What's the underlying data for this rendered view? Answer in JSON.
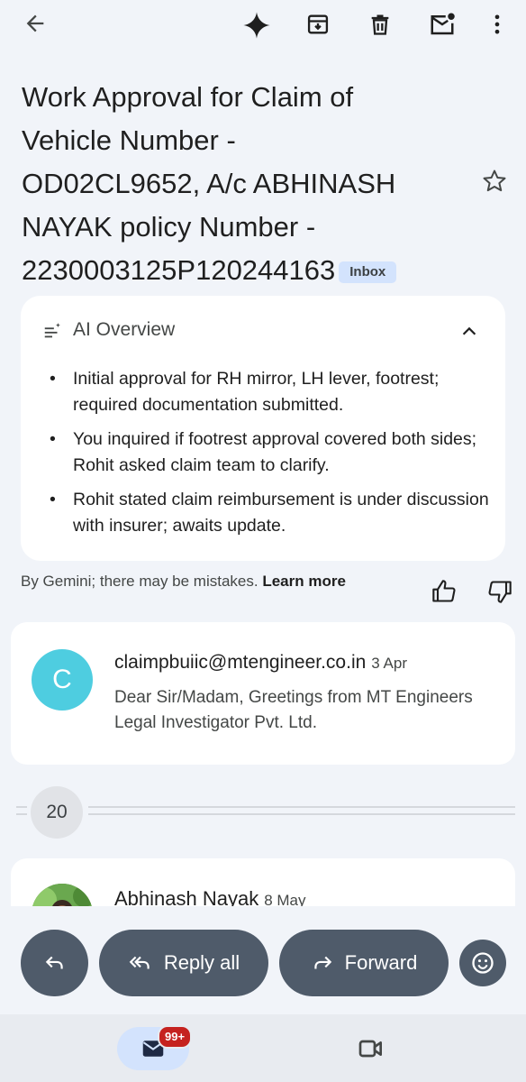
{
  "toolbar": {
    "icons": [
      "arrow-back-icon",
      "gemini-sparkle-icon",
      "archive-icon",
      "delete-icon",
      "mark-unread-icon",
      "more-vert-icon"
    ]
  },
  "subject": {
    "text": "Work Approval for Claim of Vehicle Number - OD02CL9652, A/c ABHINASH NAYAK policy Number - 2230003125P120244163",
    "label": "Inbox"
  },
  "ai_overview": {
    "title": "AI Overview",
    "points": [
      "Initial approval for RH mirror, LH lever, footrest; required documentation submitted.",
      "You inquired if footrest approval covered both sides; Rohit asked claim team to clarify.",
      "Rohit stated claim reimbursement is under discussion with insurer; awaits update."
    ],
    "disclaimer": "By Gemini; there may be mistakes.",
    "learn_more": "Learn more"
  },
  "messages": [
    {
      "avatar_letter": "C",
      "avatar_color": "#4ecde0",
      "sender": "claimpbuiic@mtengineer.co.in",
      "date": "3 Apr",
      "snippet": "Dear Sir/Madam, Greetings from MT Engineers Legal Investigator Pvt. Ltd."
    },
    {
      "sender": "Abhinash Nayak",
      "date": "8 May"
    }
  ],
  "collapsed_count": "20",
  "actions": {
    "reply_all": "Reply all",
    "forward": "Forward"
  },
  "bottom_nav": {
    "mail_badge": "99+"
  },
  "colors": {
    "background": "#f1f4f9",
    "card": "#ffffff",
    "pill": "#4f5b6a",
    "badge": "#c5221f",
    "inbox_label_bg": "#d3e3fd"
  }
}
